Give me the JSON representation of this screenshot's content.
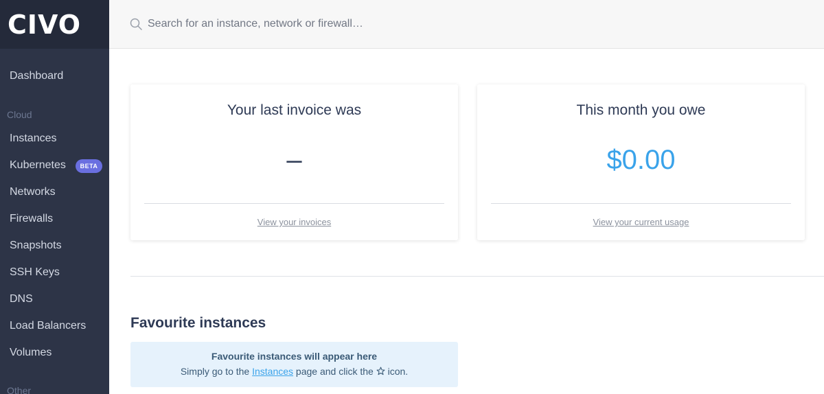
{
  "brand": {
    "logo_text": "CIVO"
  },
  "sidebar": {
    "dashboard": "Dashboard",
    "cloud_section": "Cloud",
    "items": [
      {
        "label": "Instances"
      },
      {
        "label": "Kubernetes",
        "badge": "BETA"
      },
      {
        "label": "Networks"
      },
      {
        "label": "Firewalls"
      },
      {
        "label": "Snapshots"
      },
      {
        "label": "SSH Keys"
      },
      {
        "label": "DNS"
      },
      {
        "label": "Load Balancers"
      },
      {
        "label": "Volumes"
      }
    ],
    "other_section": "Other"
  },
  "search": {
    "placeholder": "Search for an instance, network or firewall…",
    "icon": "search-icon"
  },
  "invoice_card": {
    "title": "Your last invoice was",
    "value": "–",
    "link": "View your invoices"
  },
  "usage_card": {
    "title": "This month you owe",
    "value": "$0.00",
    "link": "View your current usage"
  },
  "favourites": {
    "heading": "Favourite instances",
    "box_title": "Favourite instances will appear here",
    "text_before": "Simply go to the ",
    "link": "Instances",
    "text_middle": " page and click the ",
    "icon": "star-icon",
    "text_after": " icon."
  },
  "colors": {
    "sidebar_bg": "#2d3447",
    "accent_blue": "#3aa3ea",
    "beta_badge": "#6a6fe0",
    "info_box_bg": "#e6f2fc"
  }
}
